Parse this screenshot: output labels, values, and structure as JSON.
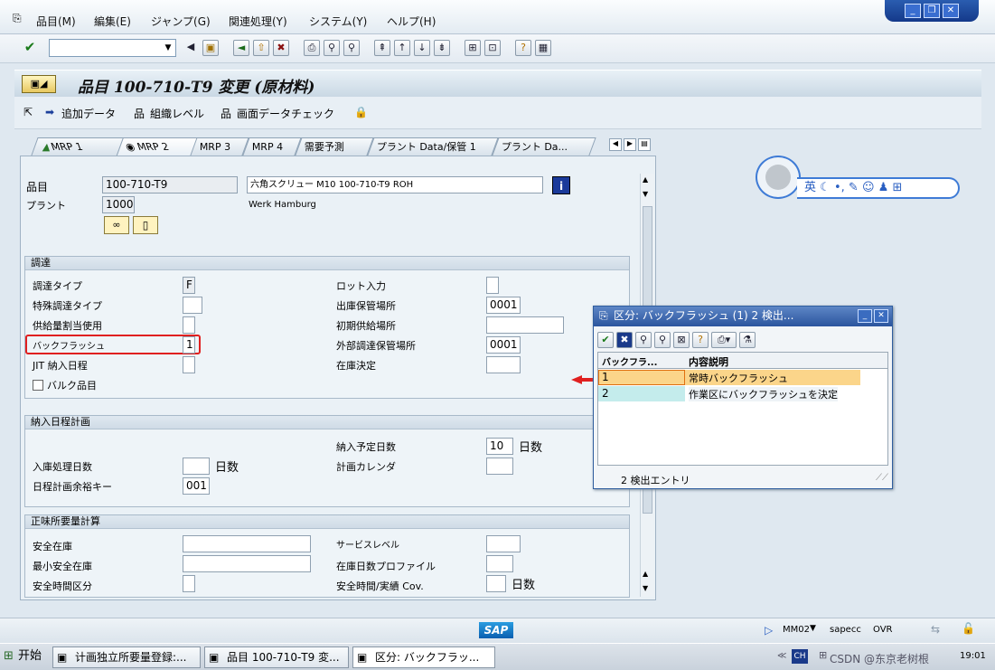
{
  "menu": [
    "品目(M)",
    "編集(E)",
    "ジャンプ(G)",
    "関連処理(Y)",
    "システム(Y)",
    "ヘルプ(H)"
  ],
  "title": "品目 100-710-T9 変更 (原材料)",
  "appbar": {
    "add": "追加データ",
    "org": "組織レベル",
    "check": "画面データチェック"
  },
  "tabs": [
    "MRP 1",
    "MRP 2",
    "MRP 3",
    "MRP 4",
    "需要予測",
    "プラント Data/保管 1",
    "プラント Da..."
  ],
  "header": {
    "material_label": "品目",
    "material": "100-710-T9",
    "desc": "六角スクリュー M10 100-710-T9 ROH",
    "plant_label": "プラント",
    "plant": "1000",
    "plant_name": "Werk Hamburg"
  },
  "proc": {
    "title": "調達",
    "type_label": "調達タイプ",
    "type": "F",
    "special_label": "特殊調達タイプ",
    "batch_label": "供給量割当使用",
    "backflush_label": "バックフラッシュ",
    "backflush": "1",
    "jit_label": "JIT 納入日程",
    "bulk_label": "バルク品目",
    "lot_label": "ロット入力",
    "issue_label": "出庫保管場所",
    "issue": "0001",
    "supply_label": "初期供給場所",
    "ext_label": "外部調達保管場所",
    "ext": "0001",
    "stock_label": "在庫決定"
  },
  "sched": {
    "title": "納入日程計画",
    "gr_label": "入庫処理日数",
    "gr_unit": "日数",
    "margin_label": "日程計画余裕キー",
    "margin": "001",
    "pdt_label": "納入予定日数",
    "pdt": "10",
    "pdt_unit": "日数",
    "cal_label": "計画カレンダ"
  },
  "net": {
    "title": "正味所要量計算",
    "ss_label": "安全在庫",
    "min_label": "最小安全在庫",
    "st_label": "安全時間区分",
    "sl_label": "サービスレベル",
    "cov_label": "在庫日数プロファイル",
    "safe_label": "安全時間/実績 Cov.",
    "safe_unit": "日数"
  },
  "popup": {
    "title": "区分: バックフラッシュ (1)  2 検出...",
    "col1": "バックフラ...",
    "col2": "内容説明",
    "rows": [
      {
        "k": "1",
        "d": "常時バックフラッシュ"
      },
      {
        "k": "2",
        "d": "作業区にバックフラッシュを決定"
      }
    ],
    "footer": "2 検出エントリ"
  },
  "sticker": {
    "text": "英"
  },
  "status": {
    "tcode": "MM02",
    "sys": "sapecc",
    "mode": "OVR",
    "brand": "SAP"
  },
  "taskbar": {
    "start": "开始",
    "t1": "计画独立所要量登録:...",
    "t2": "品目 100-710-T9 変...",
    "t3": "区分: バックフラッ...",
    "lang": "CH",
    "time": "19:01",
    "watermark": "CSDN @东京老树根"
  }
}
